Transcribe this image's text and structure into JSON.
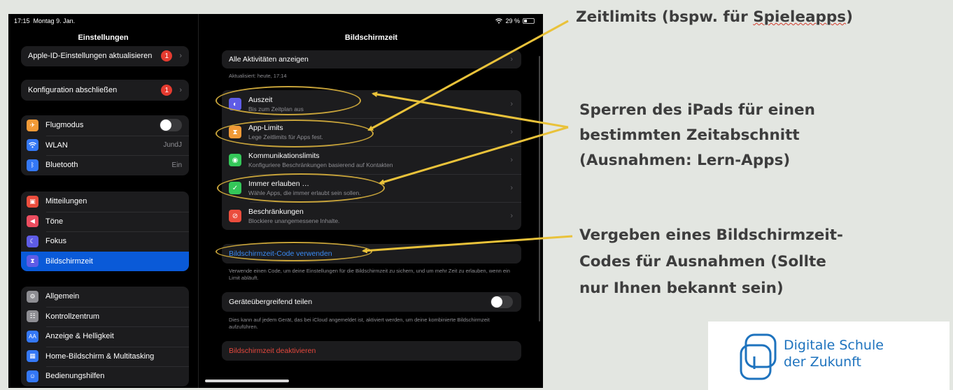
{
  "status": {
    "time": "17:15",
    "date": "Montag 9. Jan.",
    "battery": "29 %"
  },
  "sidebar": {
    "title": "Einstellungen",
    "apple_id": {
      "label": "Apple-ID-Einstellungen aktualisieren",
      "badge": "1"
    },
    "config": {
      "label": "Konfiguration abschließen",
      "badge": "1"
    },
    "connectivity": [
      {
        "label": "Flugmodus",
        "icon": "airplane-icon",
        "color": "#f19a37",
        "value": ""
      },
      {
        "label": "WLAN",
        "icon": "wifi-icon",
        "color": "#3478f6",
        "value": "JundJ"
      },
      {
        "label": "Bluetooth",
        "icon": "bluetooth-icon",
        "color": "#3478f6",
        "value": "Ein"
      }
    ],
    "notifications": [
      {
        "label": "Mitteilungen",
        "icon": "bell-icon",
        "color": "#eb4d3d"
      },
      {
        "label": "Töne",
        "icon": "speaker-icon",
        "color": "#eb4d5f"
      },
      {
        "label": "Fokus",
        "icon": "moon-icon",
        "color": "#5e5ce6"
      },
      {
        "label": "Bildschirmzeit",
        "icon": "hourglass-icon",
        "color": "#5e5ce6"
      }
    ],
    "general": [
      {
        "label": "Allgemein",
        "icon": "gear-icon",
        "color": "#8e8e93"
      },
      {
        "label": "Kontrollzentrum",
        "icon": "switches-icon",
        "color": "#8e8e93"
      },
      {
        "label": "Anzeige & Helligkeit",
        "icon": "aa-icon",
        "color": "#3478f6"
      },
      {
        "label": "Home-Bildschirm & Multitasking",
        "icon": "grid-icon",
        "color": "#3478f6"
      },
      {
        "label": "Bedienungshilfen",
        "icon": "accessibility-icon",
        "color": "#3478f6"
      }
    ]
  },
  "detail": {
    "title": "Bildschirmzeit",
    "all_activity": "Alle Aktivitäten anzeigen",
    "updated": "Aktualisiert: heute, 17:14",
    "items": [
      {
        "label": "Auszeit",
        "sub": "Bis zum Zeitplan aus",
        "icon": "downtime-icon",
        "color": "#5e5ce6"
      },
      {
        "label": "App-Limits",
        "sub": "Lege Zeitlimits für Apps fest.",
        "icon": "hourglass-icon",
        "color": "#f19a37"
      },
      {
        "label": "Kommunikationslimits",
        "sub": "Konfiguriere Beschränkungen basierend auf Kontakten",
        "icon": "contact-icon",
        "color": "#34c759"
      },
      {
        "label": "Immer erlauben …",
        "sub": "Wähle Apps, die immer erlaubt sein sollen.",
        "icon": "checkmark-icon",
        "color": "#34c759"
      },
      {
        "label": "Beschränkungen",
        "sub": "Blockiere unangemessene Inhalte.",
        "icon": "restriction-icon",
        "color": "#eb4d3d"
      }
    ],
    "passcode": "Bildschirmzeit-Code verwenden",
    "passcode_note": "Verwende einen Code, um deine Einstellungen für die Bildschirmzeit zu sichern, und um mehr Zeit zu erlauben, wenn ein Limit abläuft.",
    "share": "Geräteübergreifend teilen",
    "share_note": "Dies kann auf jedem Gerät, das bei iCloud angemeldet ist, aktiviert werden, um deine kombinierte Bildschirmzeit aufzuführen.",
    "deactivate": "Bildschirmzeit deaktivieren"
  },
  "annotations": {
    "zeitlimits_before": "Zeitlimits (bspw. für ",
    "zeitlimits_squiggle": "Spieleapps",
    "zeitlimits_after": ")",
    "sperren": [
      "Sperren des iPads für einen",
      "bestimmten Zeitabschnitt",
      "(Ausnahmen: Lern-Apps)"
    ],
    "vergeben": [
      "Vergeben eines Bildschirmzeit-",
      "Codes für Ausnahmen (Sollte",
      "nur Ihnen bekannt sein)"
    ]
  },
  "logo": {
    "line1": "Digitale Schule",
    "line2": "der Zukunft",
    "color": "#1e73be"
  },
  "colors": {
    "highlight": "#c7a33a",
    "selected": "#0a5ad8",
    "link": "#3a8bf5",
    "danger": "#e5483d"
  }
}
